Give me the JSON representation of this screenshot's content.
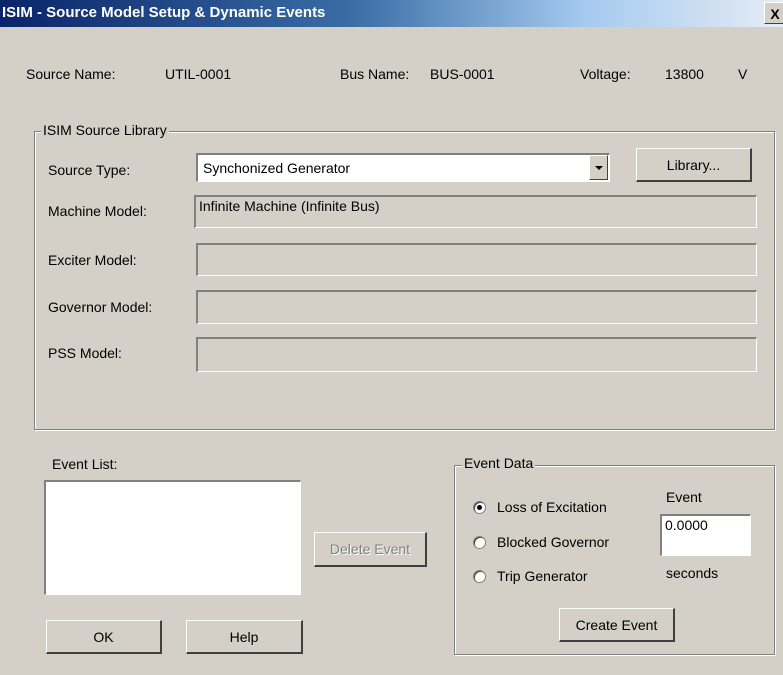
{
  "window": {
    "title": "ISIM - Source Model Setup & Dynamic Events",
    "close_glyph": "X"
  },
  "header": {
    "source_name_label": "Source Name:",
    "source_name_value": "UTIL-0001",
    "bus_name_label": "Bus Name:",
    "bus_name_value": "BUS-0001",
    "voltage_label": "Voltage:",
    "voltage_value": "13800",
    "voltage_unit": "V"
  },
  "library_group": {
    "legend": "ISIM Source Library",
    "source_type_label": "Source Type:",
    "source_type_value": "Synchonized Generator",
    "library_button": "Library...",
    "machine_model_label": "Machine Model:",
    "machine_model_value": "Infinite Machine (Infinite Bus)",
    "exciter_model_label": "Exciter Model:",
    "exciter_model_value": "",
    "governor_model_label": "Governor Model:",
    "governor_model_value": "",
    "pss_model_label": "PSS Model:",
    "pss_model_value": ""
  },
  "event_list": {
    "label": "Event List:",
    "items": [],
    "delete_button": "Delete Event"
  },
  "buttons": {
    "ok": "OK",
    "help": "Help"
  },
  "event_data": {
    "legend": "Event Data",
    "options": [
      {
        "label": "Loss of Excitation",
        "selected": true
      },
      {
        "label": "Blocked Governor",
        "selected": false
      },
      {
        "label": "Trip Generator",
        "selected": false
      }
    ],
    "event_label": "Event",
    "time_value": "0.0000",
    "seconds_label": "seconds",
    "create_button": "Create Event"
  },
  "icons": {
    "dropdown": "chevron-down-icon",
    "close": "close-icon"
  }
}
